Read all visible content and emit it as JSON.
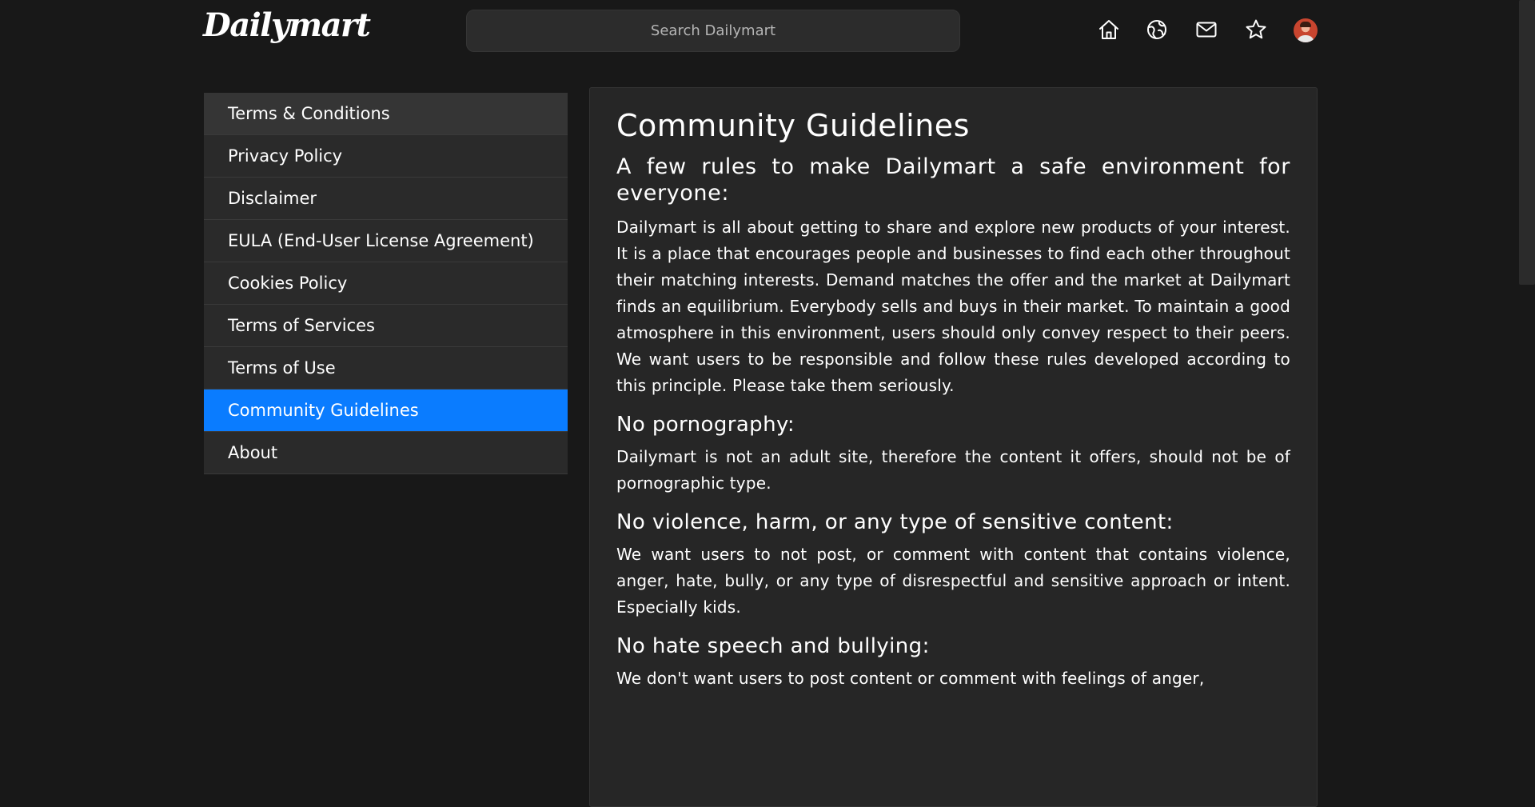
{
  "header": {
    "logo_text": "Dailymart",
    "search_placeholder": "Search Dailymart",
    "icons": [
      "home-icon",
      "explore-icon",
      "mail-icon",
      "star-icon",
      "avatar"
    ]
  },
  "sidebar": {
    "items": [
      {
        "label": "Terms & Conditions"
      },
      {
        "label": "Privacy Policy"
      },
      {
        "label": "Disclaimer"
      },
      {
        "label": "EULA (End-User License Agreement)"
      },
      {
        "label": "Cookies Policy"
      },
      {
        "label": "Terms of Services"
      },
      {
        "label": "Terms of Use"
      },
      {
        "label": "Community Guidelines"
      },
      {
        "label": "About"
      }
    ],
    "active_item": "Community Guidelines",
    "accent_color": "#0a7cff"
  },
  "main": {
    "title": "Community Guidelines",
    "lead_title": "A few rules to make Dailymart a safe environment for everyone:",
    "lead_paragraph": "Dailymart is all about getting to share and explore new products of your interest. It is a place that encourages people and businesses to find each other throughout their matching interests. Demand matches the offer and the market at Dailymart finds an equilibrium. Everybody sells and buys in their market. To maintain a good atmosphere in this environment, users should only convey respect to their peers. We want users to be responsible and follow these rules developed according to this principle. Please take them seriously.",
    "sections": [
      {
        "heading": "No pornography:",
        "text": "Dailymart is not an adult site, therefore the content it offers, should not be of pornographic type."
      },
      {
        "heading": "No violence, harm, or any type of sensitive content:",
        "text": "We want users to not post, or comment with content that contains violence, anger, hate, bully, or any type of disrespectful and sensitive approach or intent. Especially kids."
      },
      {
        "heading": "No hate speech and bullying:",
        "text": "We don't want users to post content or comment with feelings of anger,"
      }
    ]
  }
}
